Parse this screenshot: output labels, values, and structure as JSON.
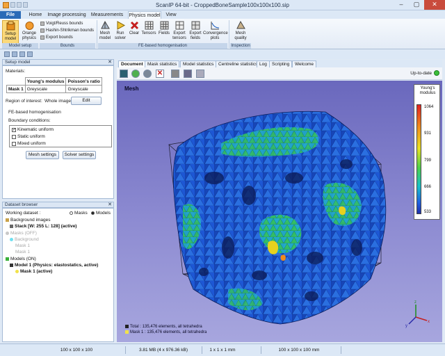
{
  "window": {
    "title": "ScanIP 64-bit - CroppedBoneSample100x100x100.sip",
    "min": "–",
    "max": "▢",
    "close": "✕"
  },
  "tabs": [
    "File",
    "Home",
    "Image processing",
    "Measurements",
    "Physics model",
    "View"
  ],
  "active_tab": "Physics model",
  "ribbon": {
    "setup_model": "Setup model",
    "orange_physics": "Orange physics",
    "voigt": "Voigt/Reuss bounds",
    "hashin": "Hashin-Shtrikman bounds",
    "export_bounds": "Export bounds",
    "mesh_model": "Mesh model",
    "run_solver": "Run solver",
    "clear": "Clear",
    "tensors": "Tensors",
    "fields": "Fields",
    "export_tensors": "Export tensors",
    "export_fields": "Export fields",
    "convergence_plots": "Convergence plots",
    "mesh_quality": "Mesh quality",
    "groups": [
      "Model setup",
      "Bounds",
      "FE-based homogenisation",
      "Inspection"
    ]
  },
  "setup_panel": {
    "header": "Setup model",
    "materials_label": "Materials:",
    "col_young": "Young's modulus",
    "col_poisson": "Poisson's ratio",
    "row_name": "Mask 1",
    "row_young": "Greyscale",
    "row_poisson": "Greyscale",
    "roi_label": "Region of interest:",
    "roi_value": "Whole image",
    "edit": "Edit",
    "fe_label": "FE-based homogenisation",
    "bc_label": "Boundary conditions:",
    "bc_options": [
      {
        "label": "Kinematic uniform",
        "checked": true
      },
      {
        "label": "Static uniform",
        "checked": false
      },
      {
        "label": "Mixed uniform",
        "checked": false
      }
    ],
    "mesh_settings": "Mesh settings",
    "solver_settings": "Solver settings"
  },
  "dataset_browser": {
    "header": "Dataset browser",
    "working_label": "Working dataset :",
    "masks": "Masks",
    "models": "Models",
    "selected": "Models",
    "bg_images": "Background images",
    "stack": "Stack [W: 255 L: 128] (active)",
    "masks_off": "Masks (OFF)",
    "background": "Background",
    "mask1": "Mask 1",
    "mask1b": "Mask 1",
    "models_on": "Models (ON)",
    "model1": "Model 1 (Physics: elastostatics, active)",
    "model_mask": "Mask 1 (active)"
  },
  "doc_tabs": [
    "Document",
    "Mask statistics",
    "Model statistics",
    "Centreline statistics",
    "Log",
    "Scripting",
    "Welcome"
  ],
  "up_to_date": "Up-to-date",
  "viewport": {
    "title": "Mesh",
    "legend_title": "Young's modulus",
    "legend_ticks": [
      "1064",
      "931",
      "799",
      "666",
      "533"
    ],
    "info_total": "Total : 135,476 elements, all tetrahedra",
    "info_mask": "Mask 1 : 135,476 elements, all tetrahedra",
    "colors": {
      "bg_top": "#6a68bd",
      "bg_bottom": "#a7a6de",
      "mesh_blue": "#1a4fd0",
      "mesh_green": "#2ec45a"
    }
  },
  "statusbar": [
    "100 x 100 x 100",
    "3.81 MB (4 x 976.36 kB)",
    "1 x 1 x 1 mm",
    "100 x 100 x 100 mm"
  ]
}
